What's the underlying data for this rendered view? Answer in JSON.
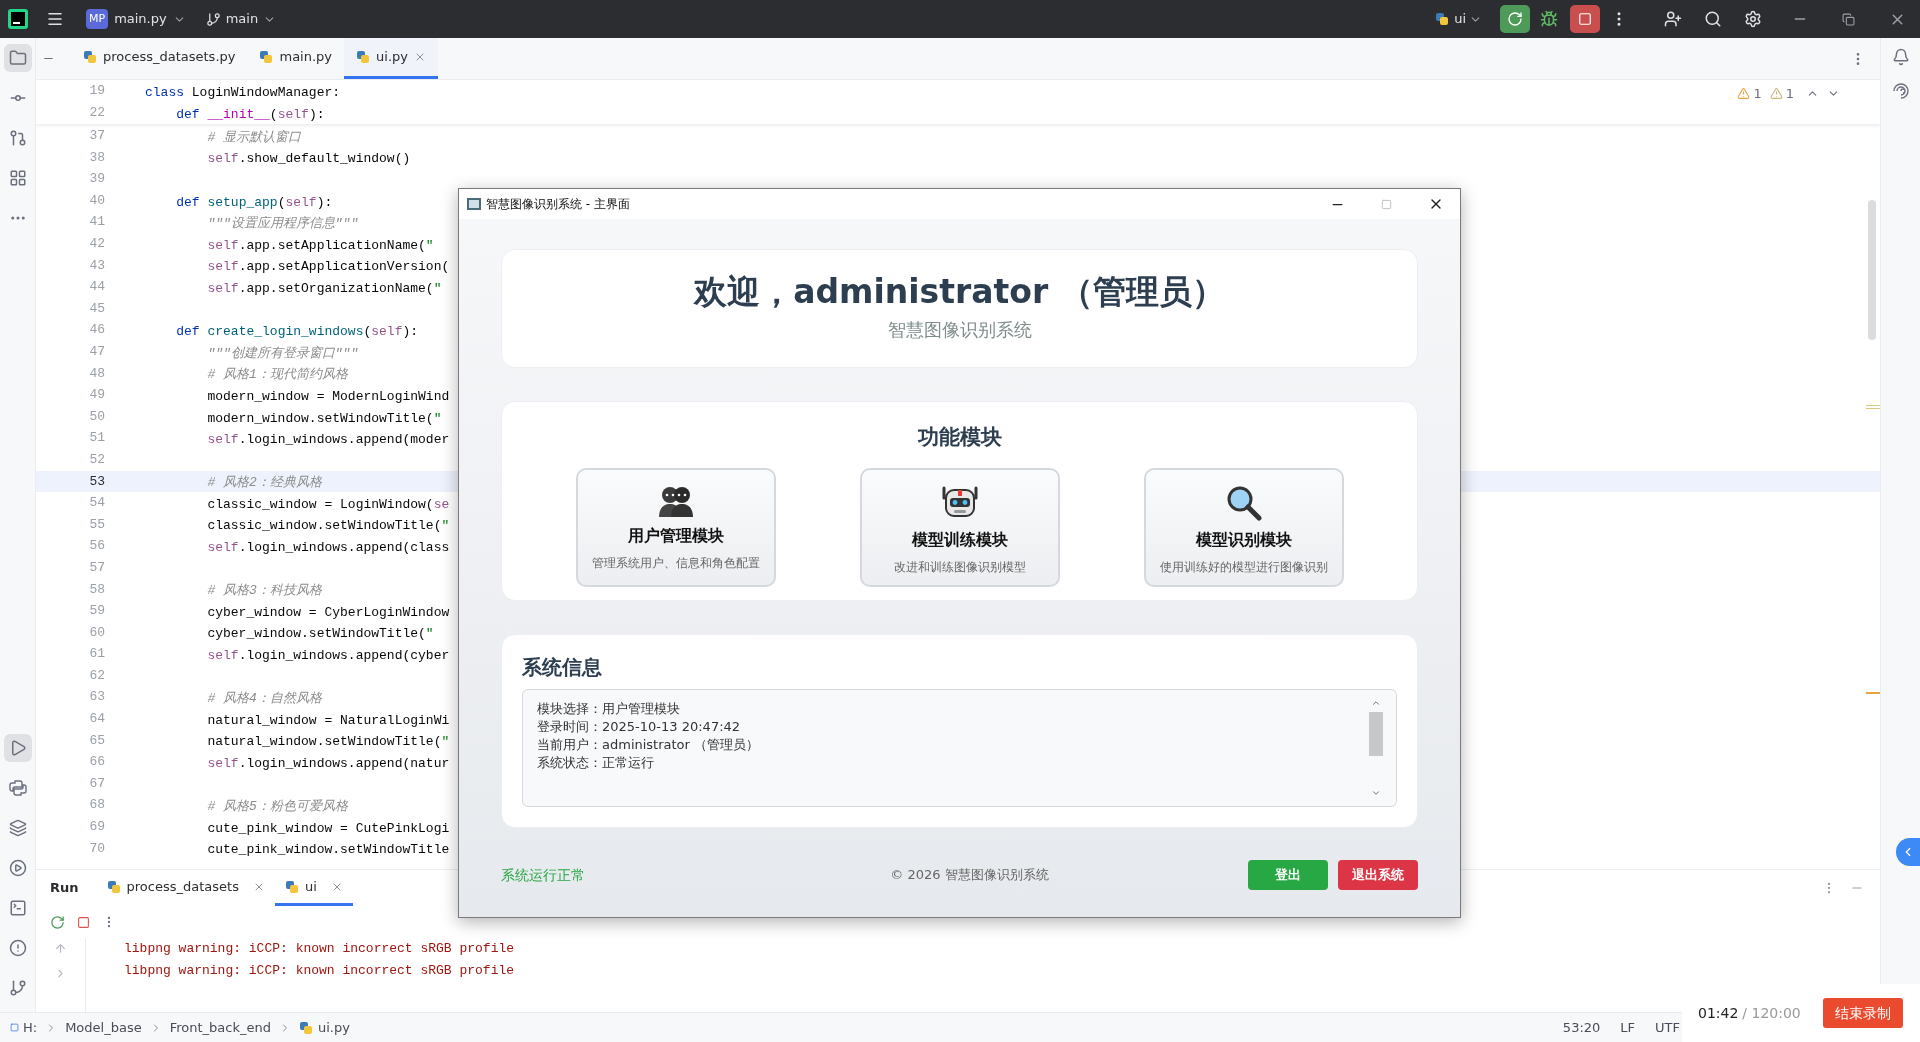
{
  "title_bar": {
    "project_badge": "MP",
    "project": "main.py",
    "branch": "main",
    "run_config": "ui"
  },
  "tool_windows_top": [
    {
      "kind": "folder",
      "selected": true
    },
    {
      "kind": "commit",
      "selected": false
    },
    {
      "kind": "pull",
      "selected": false
    },
    {
      "kind": "structure",
      "selected": false
    },
    {
      "kind": "more",
      "selected": false
    }
  ],
  "tool_windows_bottom": [
    {
      "kind": "run",
      "selected": true
    },
    {
      "kind": "python",
      "selected": false
    },
    {
      "kind": "layers",
      "selected": false
    },
    {
      "kind": "services",
      "selected": false
    },
    {
      "kind": "terminal",
      "selected": false
    },
    {
      "kind": "problems",
      "selected": false
    },
    {
      "kind": "git",
      "selected": false
    }
  ],
  "editor_tabs": [
    {
      "label": "process_datasets.py",
      "selected": false
    },
    {
      "label": "main.py",
      "selected": false
    },
    {
      "label": "ui.py",
      "selected": true
    }
  ],
  "inspections": [
    "1",
    "1"
  ],
  "sticky_lines": [
    {
      "num": "19",
      "parts": [
        {
          "kind": "keyword",
          "text": "class "
        },
        {
          "kind": "plain",
          "text": "LoginWindowManager:"
        }
      ]
    },
    {
      "num": "22",
      "parts": [
        {
          "kind": "keyword",
          "text": "    def "
        },
        {
          "kind": "magic",
          "text": "__init__"
        },
        {
          "kind": "plain",
          "text": "("
        },
        {
          "kind": "self",
          "text": "self"
        },
        {
          "kind": "plain",
          "text": "):"
        }
      ]
    }
  ],
  "code_lines": [
    {
      "num": "37",
      "current": false,
      "parts": [
        {
          "kind": "comment",
          "text": "        # 显示默认窗口"
        }
      ]
    },
    {
      "num": "38",
      "current": false,
      "parts": [
        {
          "kind": "self",
          "text": "        self"
        },
        {
          "kind": "plain",
          "text": ".show_default_window()"
        }
      ]
    },
    {
      "num": "39",
      "current": false
    },
    {
      "num": "40",
      "current": false,
      "parts": [
        {
          "kind": "keyword",
          "text": "    def "
        },
        {
          "kind": "function",
          "text": "setup_app"
        },
        {
          "kind": "plain",
          "text": "("
        },
        {
          "kind": "self",
          "text": "self"
        },
        {
          "kind": "plain",
          "text": "):"
        }
      ]
    },
    {
      "num": "41",
      "current": false,
      "parts": [
        {
          "kind": "comment",
          "text": "        \"\"\"设置应用程序信息\"\"\""
        }
      ]
    },
    {
      "num": "42",
      "current": false,
      "parts": [
        {
          "kind": "self",
          "text": "        self"
        },
        {
          "kind": "plain",
          "text": ".app.setApplicationName("
        },
        {
          "kind": "string",
          "text": "\""
        }
      ]
    },
    {
      "num": "43",
      "current": false,
      "parts": [
        {
          "kind": "self",
          "text": "        self"
        },
        {
          "kind": "plain",
          "text": ".app.setApplicationVersion("
        }
      ]
    },
    {
      "num": "44",
      "current": false,
      "parts": [
        {
          "kind": "self",
          "text": "        self"
        },
        {
          "kind": "plain",
          "text": ".app.setOrganizationName("
        },
        {
          "kind": "string",
          "text": "\""
        }
      ]
    },
    {
      "num": "45",
      "current": false
    },
    {
      "num": "46",
      "current": false,
      "parts": [
        {
          "kind": "keyword",
          "text": "    def "
        },
        {
          "kind": "function",
          "text": "create_login_windows"
        },
        {
          "kind": "plain",
          "text": "("
        },
        {
          "kind": "self",
          "text": "self"
        },
        {
          "kind": "plain",
          "text": "):"
        }
      ]
    },
    {
      "num": "47",
      "current": false,
      "parts": [
        {
          "kind": "comment",
          "text": "        \"\"\"创建所有登录窗口\"\"\""
        }
      ]
    },
    {
      "num": "48",
      "current": false,
      "parts": [
        {
          "kind": "comment",
          "text": "        # 风格1：现代简约风格"
        }
      ]
    },
    {
      "num": "49",
      "current": false,
      "parts": [
        {
          "kind": "plain",
          "text": "        modern_window = ModernLoginWind"
        }
      ]
    },
    {
      "num": "50",
      "current": false,
      "parts": [
        {
          "kind": "plain",
          "text": "        modern_window.setWindowTitle("
        },
        {
          "kind": "string",
          "text": "\""
        }
      ]
    },
    {
      "num": "51",
      "current": false,
      "parts": [
        {
          "kind": "self",
          "text": "        self"
        },
        {
          "kind": "plain",
          "text": ".login_windows.append(moder"
        }
      ]
    },
    {
      "num": "52",
      "current": false
    },
    {
      "num": "53",
      "current": true,
      "parts": [
        {
          "kind": "comment",
          "text": "        # 风格2：经典风格"
        }
      ]
    },
    {
      "num": "54",
      "current": false,
      "parts": [
        {
          "kind": "plain",
          "text": "        classic_window = LoginWindow("
        },
        {
          "kind": "self",
          "text": "se"
        }
      ]
    },
    {
      "num": "55",
      "current": false,
      "parts": [
        {
          "kind": "plain",
          "text": "        classic_window.setWindowTitle("
        },
        {
          "kind": "string",
          "text": "\""
        }
      ]
    },
    {
      "num": "56",
      "current": false,
      "parts": [
        {
          "kind": "self",
          "text": "        self"
        },
        {
          "kind": "plain",
          "text": ".login_windows.append(class"
        }
      ]
    },
    {
      "num": "57",
      "current": false
    },
    {
      "num": "58",
      "current": false,
      "parts": [
        {
          "kind": "comment",
          "text": "        # 风格3：科技风格"
        }
      ]
    },
    {
      "num": "59",
      "current": false,
      "parts": [
        {
          "kind": "plain",
          "text": "        cyber_window = CyberLoginWindow"
        }
      ]
    },
    {
      "num": "60",
      "current": false,
      "parts": [
        {
          "kind": "plain",
          "text": "        cyber_window.setWindowTitle("
        },
        {
          "kind": "string",
          "text": "\""
        }
      ]
    },
    {
      "num": "61",
      "current": false,
      "parts": [
        {
          "kind": "self",
          "text": "        self"
        },
        {
          "kind": "plain",
          "text": ".login_windows.append(cyber"
        }
      ]
    },
    {
      "num": "62",
      "current": false
    },
    {
      "num": "63",
      "current": false,
      "parts": [
        {
          "kind": "comment",
          "text": "        # 风格4：自然风格"
        }
      ]
    },
    {
      "num": "64",
      "current": false,
      "parts": [
        {
          "kind": "plain",
          "text": "        natural_window = NaturalLoginWi"
        }
      ]
    },
    {
      "num": "65",
      "current": false,
      "parts": [
        {
          "kind": "plain",
          "text": "        natural_window.setWindowTitle("
        },
        {
          "kind": "string",
          "text": "\""
        }
      ]
    },
    {
      "num": "66",
      "current": false,
      "parts": [
        {
          "kind": "self",
          "text": "        self"
        },
        {
          "kind": "plain",
          "text": ".login_windows.append(natur"
        }
      ]
    },
    {
      "num": "67",
      "current": false
    },
    {
      "num": "68",
      "current": false,
      "parts": [
        {
          "kind": "comment",
          "text": "        # 风格5：粉色可爱风格"
        }
      ]
    },
    {
      "num": "69",
      "current": false,
      "parts": [
        {
          "kind": "plain",
          "text": "        cute_pink_window = CutePinkLogi"
        }
      ]
    },
    {
      "num": "70",
      "current": false,
      "parts": [
        {
          "kind": "plain",
          "text": "        cute_pink_window.setWindowTitle"
        }
      ]
    }
  ],
  "dialog": {
    "title": "智慧图像识别系统 - 主界面",
    "welcome": "欢迎，administrator （管理员）",
    "subtitle": "智慧图像识别系统",
    "modules_title": "功能模块",
    "modules": [
      {
        "kind": "users",
        "title": "用户管理模块",
        "desc": "管理系统用户、信息和角色配置"
      },
      {
        "kind": "robot",
        "title": "模型训练模块",
        "desc": "改进和训练图像识别模型"
      },
      {
        "kind": "search",
        "title": "模型识别模块",
        "desc": "使用训练好的模型进行图像识别"
      }
    ],
    "info_title": "系统信息",
    "info_lines": [
      "模块选择：用户管理模块",
      "登录时间：2025-10-13 20:47:42",
      "当前用户：administrator （管理员）",
      "系统状态：正常运行"
    ],
    "status": "系统运行正常",
    "copyright": "© 2026 智慧图像识别系统",
    "buttons": [
      {
        "label": "登出",
        "kind": "primary"
      },
      {
        "label": "退出系统",
        "kind": "danger"
      }
    ]
  },
  "run_panel": {
    "title": "Run",
    "tabs": [
      {
        "label": "process_datasets",
        "selected": false
      },
      {
        "label": "ui",
        "selected": true
      }
    ],
    "output": [
      "libpng warning: iCCP: known incorrect sRGB profile",
      "libpng warning: iCCP: known incorrect sRGB profile"
    ]
  },
  "breadcrumb": [
    "H:",
    "Model_base",
    "Front_back_end",
    "ui.py"
  ],
  "status_bar": [
    "53:20",
    "LF",
    "UTF"
  ],
  "recorder": {
    "elapsed": "01:42",
    "total": "/ 120:00",
    "button": "结束录制"
  }
}
